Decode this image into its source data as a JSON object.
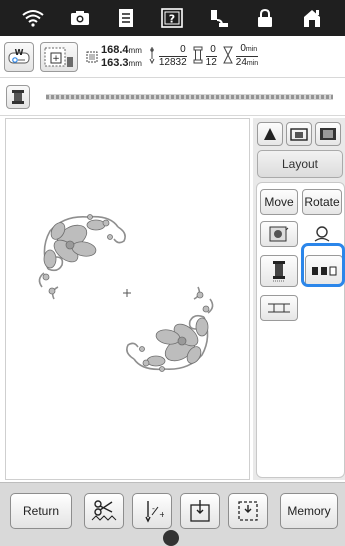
{
  "top_icons": [
    "wifi-icon",
    "camera-icon",
    "document-icon",
    "help-icon",
    "thread-spool-icon",
    "lock-icon",
    "home-icon"
  ],
  "info": {
    "size_width": "168.4",
    "size_height": "163.3",
    "size_unit": "mm",
    "stitch_current": "0",
    "stitch_total": "12832",
    "color_current": "0",
    "color_total": "12",
    "time_current": "0",
    "time_total": "24",
    "time_unit": "min"
  },
  "right_panel": {
    "layout_label": "Layout",
    "move_label": "Move",
    "rotate_label": "Rotate"
  },
  "bottom": {
    "return_label": "Return",
    "memory_label": "Memory"
  },
  "colors": {
    "topbar": "#1f1f1f",
    "highlight": "#2b86ea",
    "panel_bg": "#e9e9e9",
    "embroidery_gray": "#8f8f8f"
  }
}
